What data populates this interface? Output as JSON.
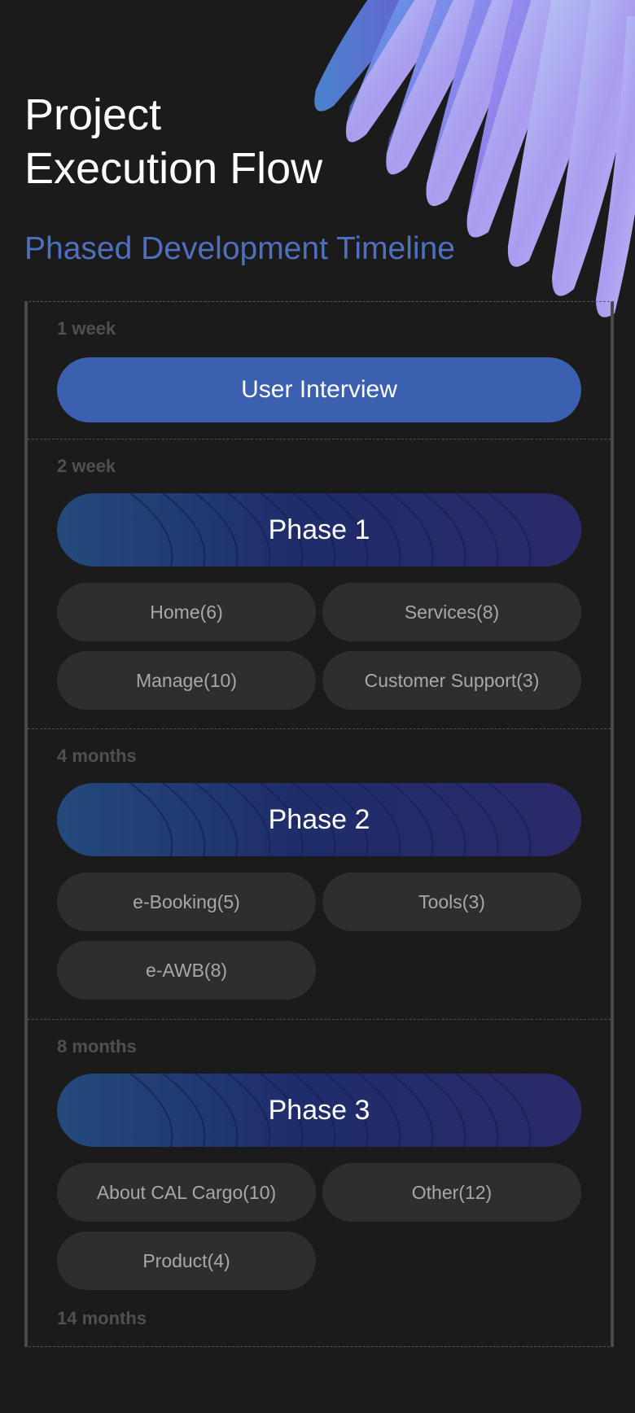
{
  "header": {
    "title_line1": "Project",
    "title_line2": "Execution Flow",
    "subtitle": "Phased Development Timeline"
  },
  "colors": {
    "background": "#1b1b1b",
    "accent": "#3b60b0",
    "subtitle": "#4f6fc0",
    "chip": "#2e2e2e"
  },
  "timeline": {
    "sections": [
      {
        "duration": "1 week",
        "label": "User Interview"
      },
      {
        "duration": "2 week",
        "phase": "Phase 1",
        "items": [
          "Home(6)",
          "Services(8)",
          "Manage(10)",
          "Customer Support(3)"
        ]
      },
      {
        "duration": "4 months",
        "phase": "Phase 2",
        "items": [
          "e-Booking(5)",
          "Tools(3)",
          "e-AWB(8)"
        ]
      },
      {
        "duration": "8 months",
        "phase": "Phase 3",
        "items": [
          "About CAL Cargo(10)",
          "Other(12)",
          "Product(4)"
        ]
      }
    ],
    "end_duration": "14 months"
  }
}
